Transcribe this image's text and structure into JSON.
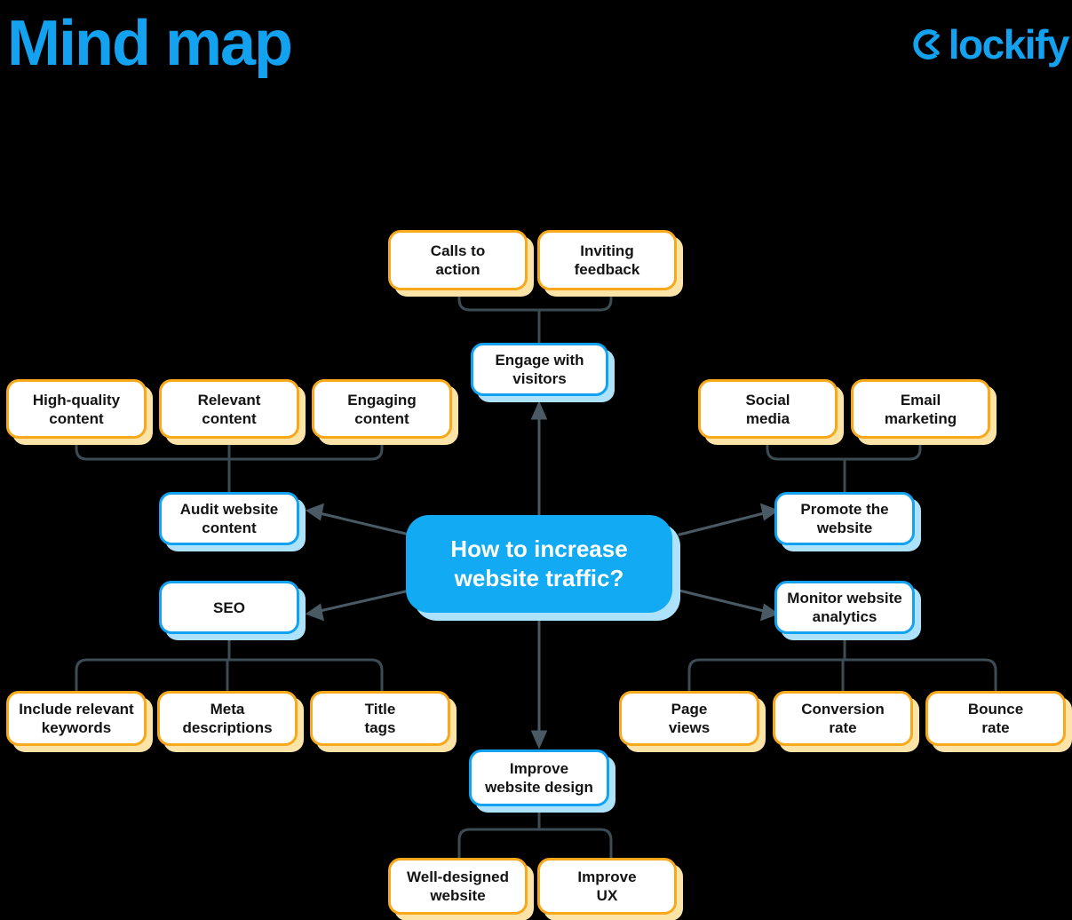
{
  "header": {
    "title": "Mind map",
    "brand_name": "lockify",
    "brand_icon": "clockify-logo-icon",
    "brand_color": "#12A2F0"
  },
  "colors": {
    "background": "#000000",
    "accent_blue": "#12A2F0",
    "central_fill": "#12AAF2",
    "central_shadow": "#AEE2FB",
    "leaf_border": "#F7A81B",
    "leaf_shadow": "#FCE3A8",
    "branch_border": "#12A2F0",
    "branch_shadow": "#AEE2FB",
    "connector": "#3C4C55",
    "node_text": "#141414",
    "central_text": "#FFFFFF"
  },
  "diagram": {
    "type": "mind-map",
    "central": {
      "id": "central",
      "label": "How to increase\nwebsite traffic?",
      "line1": "How to increase",
      "line2": "website traffic?"
    },
    "branches": [
      {
        "id": "engage-with-visitors",
        "label": "Engage with\nvisitors",
        "line1": "Engage with",
        "line2": "visitors",
        "direction": "up",
        "children": [
          {
            "id": "calls-to-action",
            "label": "Calls to\naction",
            "line1": "Calls to",
            "line2": "action"
          },
          {
            "id": "inviting-feedback",
            "label": "Inviting\nfeedback",
            "line1": "Inviting",
            "line2": "feedback"
          }
        ]
      },
      {
        "id": "audit-website-content",
        "label": "Audit website\ncontent",
        "line1": "Audit website",
        "line2": "content",
        "direction": "left-upper",
        "children": [
          {
            "id": "high-quality-content",
            "label": "High-quality\ncontent",
            "line1": "High-quality",
            "line2": "content"
          },
          {
            "id": "relevant-content",
            "label": "Relevant\ncontent",
            "line1": "Relevant",
            "line2": "content"
          },
          {
            "id": "engaging-content",
            "label": "Engaging\ncontent",
            "line1": "Engaging",
            "line2": "content"
          }
        ]
      },
      {
        "id": "seo",
        "label": "SEO",
        "line1": "SEO",
        "line2": "",
        "direction": "left-lower",
        "children": [
          {
            "id": "include-relevant-keywords",
            "label": "Include relevant\nkeywords",
            "line1": "Include relevant",
            "line2": "keywords"
          },
          {
            "id": "meta-descriptions",
            "label": "Meta\ndescriptions",
            "line1": "Meta",
            "line2": "descriptions"
          },
          {
            "id": "title-tags",
            "label": "Title\ntags",
            "line1": "Title",
            "line2": "tags"
          }
        ]
      },
      {
        "id": "promote-the-website",
        "label": "Promote the\nwebsite",
        "line1": "Promote the",
        "line2": "website",
        "direction": "right-upper",
        "children": [
          {
            "id": "social-media",
            "label": "Social\nmedia",
            "line1": "Social",
            "line2": "media"
          },
          {
            "id": "email-marketing",
            "label": "Email\nmarketing",
            "line1": "Email",
            "line2": "marketing"
          }
        ]
      },
      {
        "id": "monitor-website-analytics",
        "label": "Monitor website\nanalytics",
        "line1": "Monitor website",
        "line2": "analytics",
        "direction": "right-lower",
        "children": [
          {
            "id": "page-views",
            "label": "Page\nviews",
            "line1": "Page",
            "line2": "views"
          },
          {
            "id": "conversion-rate",
            "label": "Conversion\nrate",
            "line1": "Conversion",
            "line2": "rate"
          },
          {
            "id": "bounce-rate",
            "label": "Bounce\nrate",
            "line1": "Bounce",
            "line2": "rate"
          }
        ]
      },
      {
        "id": "improve-website-design",
        "label": "Improve\nwebsite design",
        "line1": "Improve",
        "line2": "website design",
        "direction": "down",
        "children": [
          {
            "id": "well-designed-website",
            "label": "Well-designed\nwebsite",
            "line1": "Well-designed",
            "line2": "website"
          },
          {
            "id": "improve-ux",
            "label": "Improve\nUX",
            "line1": "Improve",
            "line2": "UX"
          }
        ]
      }
    ]
  }
}
